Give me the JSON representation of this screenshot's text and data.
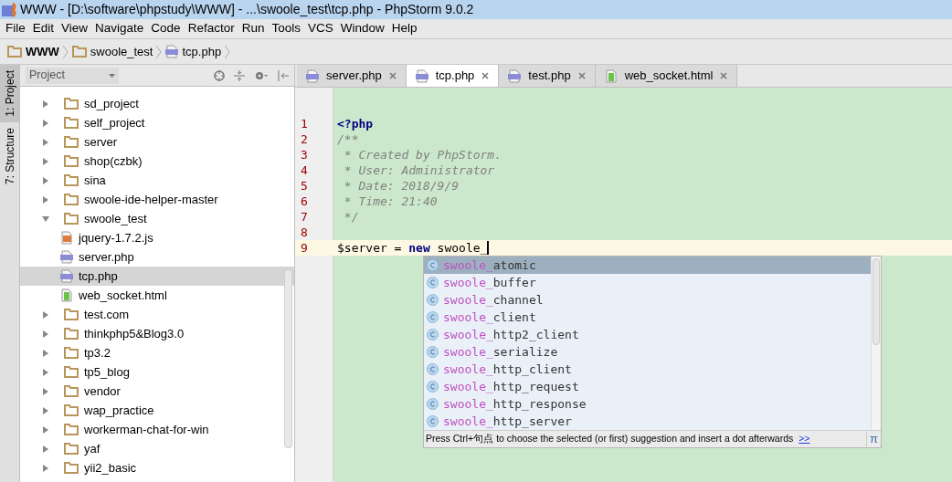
{
  "window": {
    "title": "WWW - [D:\\software\\phpstudy\\WWW] - ...\\swoole_test\\tcp.php - PhpStorm 9.0.2"
  },
  "menu": [
    "File",
    "Edit",
    "View",
    "Navigate",
    "Code",
    "Refactor",
    "Run",
    "Tools",
    "VCS",
    "Window",
    "Help"
  ],
  "breadcrumbs": [
    {
      "label": "WWW",
      "kind": "folder"
    },
    {
      "label": "swoole_test",
      "kind": "folder"
    },
    {
      "label": "tcp.php",
      "kind": "php"
    }
  ],
  "tool_strip": [
    {
      "label": "1: Project",
      "selected": true
    },
    {
      "label": "7: Structure",
      "selected": false
    }
  ],
  "project_panel": {
    "title": "Project",
    "tree": [
      {
        "label": "sd_project",
        "kind": "folder",
        "expanded": false,
        "selected": false
      },
      {
        "label": "self_project",
        "kind": "folder",
        "expanded": false,
        "selected": false
      },
      {
        "label": "server",
        "kind": "folder",
        "expanded": false,
        "selected": false
      },
      {
        "label": "shop(czbk)",
        "kind": "folder",
        "expanded": false,
        "selected": false
      },
      {
        "label": "sina",
        "kind": "folder",
        "expanded": false,
        "selected": false
      },
      {
        "label": "swoole-ide-helper-master",
        "kind": "folder",
        "expanded": false,
        "selected": false
      },
      {
        "label": "swoole_test",
        "kind": "folder",
        "expanded": true,
        "selected": false,
        "children": [
          {
            "label": "jquery-1.7.2.js",
            "kind": "js",
            "selected": false
          },
          {
            "label": "server.php",
            "kind": "php",
            "selected": false
          },
          {
            "label": "tcp.php",
            "kind": "php",
            "selected": true
          },
          {
            "label": "web_socket.html",
            "kind": "html",
            "selected": false
          }
        ]
      },
      {
        "label": "test.com",
        "kind": "folder",
        "expanded": false,
        "selected": false
      },
      {
        "label": "thinkphp5&Blog3.0",
        "kind": "folder",
        "expanded": false,
        "selected": false
      },
      {
        "label": "tp3.2",
        "kind": "folder",
        "expanded": false,
        "selected": false
      },
      {
        "label": "tp5_blog",
        "kind": "folder",
        "expanded": false,
        "selected": false
      },
      {
        "label": "vendor",
        "kind": "folder",
        "expanded": false,
        "selected": false
      },
      {
        "label": "wap_practice",
        "kind": "folder",
        "expanded": false,
        "selected": false
      },
      {
        "label": "workerman-chat-for-win",
        "kind": "folder",
        "expanded": false,
        "selected": false
      },
      {
        "label": "yaf",
        "kind": "folder",
        "expanded": false,
        "selected": false
      },
      {
        "label": "yii2_basic",
        "kind": "folder",
        "expanded": false,
        "selected": false
      }
    ]
  },
  "tabs": [
    {
      "label": "server.php",
      "kind": "php",
      "selected": false
    },
    {
      "label": "tcp.php",
      "kind": "php",
      "selected": true
    },
    {
      "label": "test.php",
      "kind": "php",
      "selected": false
    },
    {
      "label": "web_socket.html",
      "kind": "html",
      "selected": false
    }
  ],
  "editor": {
    "lines": [
      {
        "number": "1",
        "current": false,
        "tokens": [
          {
            "text": "<?php",
            "kind": "keyword"
          }
        ]
      },
      {
        "number": "2",
        "current": false,
        "tokens": [
          {
            "text": "/**",
            "kind": "comment"
          }
        ]
      },
      {
        "number": "3",
        "current": false,
        "tokens": [
          {
            "text": " * Created by PhpStorm.",
            "kind": "comment"
          }
        ]
      },
      {
        "number": "4",
        "current": false,
        "tokens": [
          {
            "text": " * User: Administrator",
            "kind": "comment"
          }
        ]
      },
      {
        "number": "5",
        "current": false,
        "tokens": [
          {
            "text": " * Date: 2018/9/9",
            "kind": "comment"
          }
        ]
      },
      {
        "number": "6",
        "current": false,
        "tokens": [
          {
            "text": " * Time: 21:40",
            "kind": "comment"
          }
        ]
      },
      {
        "number": "7",
        "current": false,
        "tokens": [
          {
            "text": " */",
            "kind": "comment"
          }
        ]
      },
      {
        "number": "8",
        "current": false
      },
      {
        "number": "9",
        "current": true,
        "tokens": [
          {
            "text": "$server = ",
            "kind": "plain"
          },
          {
            "text": "new",
            "kind": "keyword"
          },
          {
            "text": " swoole_",
            "kind": "plain"
          }
        ]
      }
    ]
  },
  "completion": {
    "items": [
      {
        "match": "swoole_",
        "rest": "atomic",
        "selected": true
      },
      {
        "match": "swoole_",
        "rest": "buffer",
        "selected": false
      },
      {
        "match": "swoole_",
        "rest": "channel",
        "selected": false
      },
      {
        "match": "swoole_",
        "rest": "client",
        "selected": false
      },
      {
        "match": "swoole_",
        "rest": "http2_client",
        "selected": false
      },
      {
        "match": "swoole_",
        "rest": "serialize",
        "selected": false
      },
      {
        "match": "swoole_",
        "rest": "http_client",
        "selected": false
      },
      {
        "match": "swoole_",
        "rest": "http_request",
        "selected": false
      },
      {
        "match": "swoole_",
        "rest": "http_response",
        "selected": false
      },
      {
        "match": "swoole_",
        "rest": "http_server",
        "selected": false
      }
    ],
    "hint": "Press Ctrl+句点 to choose the selected (or first) suggestion and insert a dot afterwards",
    "hint_link": ">>",
    "pi": "π"
  }
}
